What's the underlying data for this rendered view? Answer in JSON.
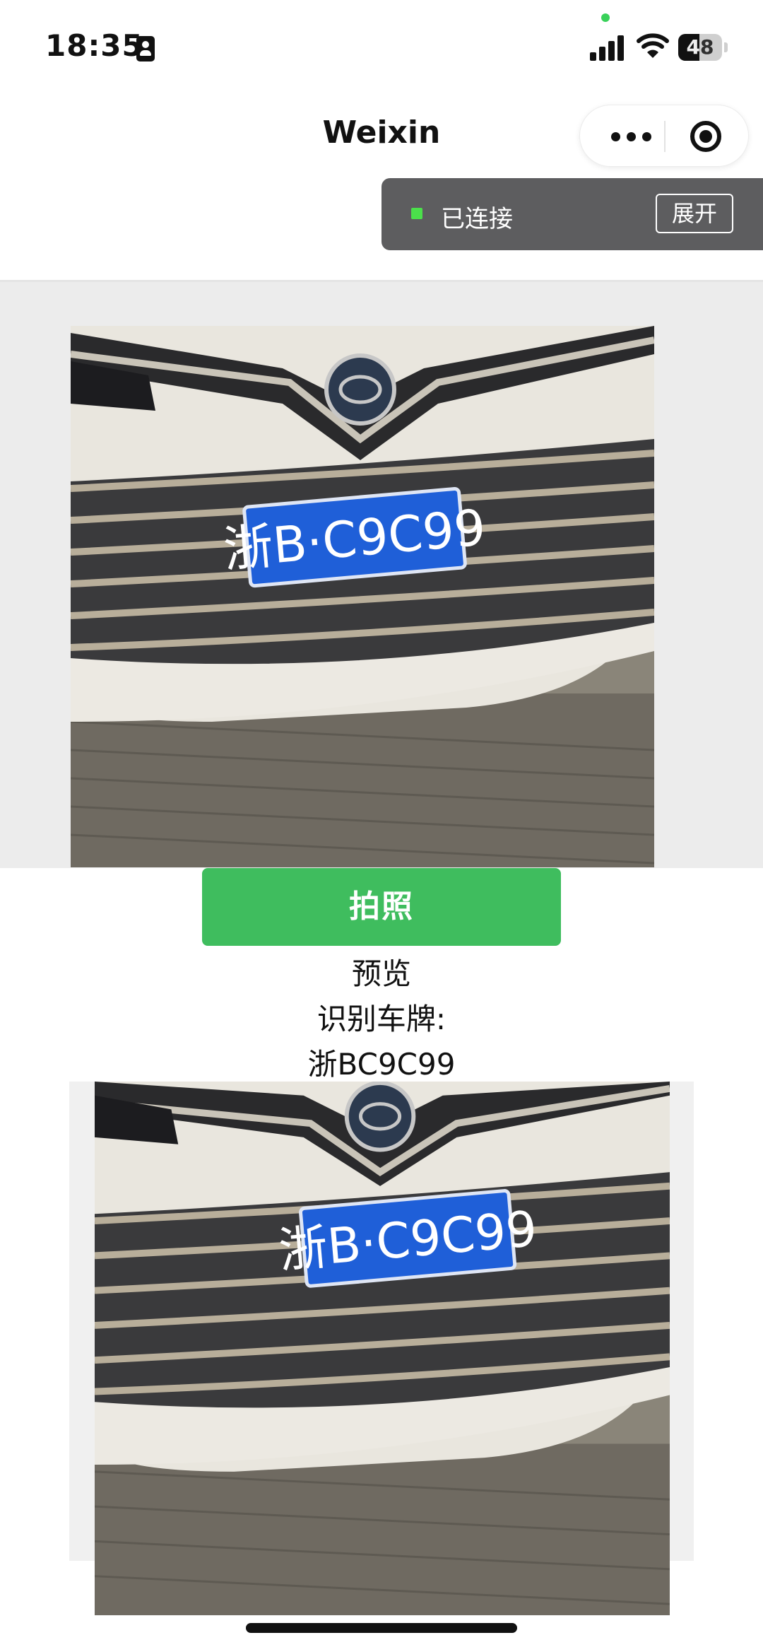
{
  "status_bar": {
    "time": "18:35",
    "battery": "48",
    "battery_level": 0.48,
    "icons": [
      "person-id-icon",
      "signal-icon",
      "wifi-icon",
      "battery-icon"
    ]
  },
  "nav": {
    "title": "Weixin",
    "more_icon": "more-dots-icon",
    "close_icon": "target-circle-icon"
  },
  "connection": {
    "status": "已连接",
    "expand_label": "展开",
    "status_color": "#4be04b"
  },
  "camera": {
    "photo_subject": "car-front-license-plate",
    "plate_text": "浙B·C9C99"
  },
  "actions": {
    "shoot_label": "拍照",
    "shoot_color": "#3fbd5e"
  },
  "result": {
    "preview_label": "预览",
    "recognize_label": "识别车牌:",
    "plate_value": "浙BC9C99"
  },
  "preview_image": {
    "plate_text": "浙B·C9C99"
  }
}
